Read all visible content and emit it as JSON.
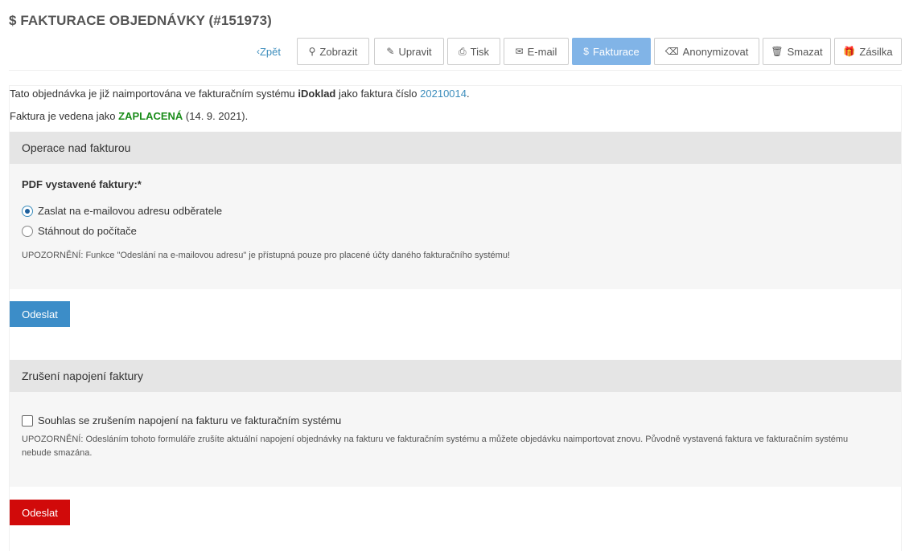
{
  "header": {
    "title": "$ FAKTURACE OBJEDNÁVKY (#151973)"
  },
  "toolbar": {
    "back": {
      "icon": "chevron-left-icon",
      "glyph": "‹",
      "label": "Zpět"
    },
    "buttons": [
      {
        "id": "zobrazit",
        "icon": "search-icon",
        "glyph": "⚲",
        "label": "Zobrazit"
      },
      {
        "id": "upravit",
        "icon": "pencil-icon",
        "glyph": "✎",
        "label": "Upravit"
      },
      {
        "id": "tisk",
        "icon": "print-icon",
        "glyph": "⎙",
        "label": "Tisk"
      },
      {
        "id": "email",
        "icon": "envelope-icon",
        "glyph": "✉",
        "label": "E-mail"
      },
      {
        "id": "fakturace",
        "icon": "dollar-icon",
        "glyph": "$",
        "label": "Fakturace",
        "active": true
      },
      {
        "id": "anonymizovat",
        "icon": "eraser-icon",
        "glyph": "⌫",
        "label": "Anonymizovat"
      },
      {
        "id": "smazat",
        "icon": "trash-icon",
        "glyph": "🗑",
        "label": "Smazat"
      },
      {
        "id": "zasilka",
        "icon": "gift-icon",
        "glyph": "🎁",
        "label": "Zásilka"
      }
    ]
  },
  "info": {
    "line1_prefix": "Tato objednávka je již naimportována ve fakturačním systému ",
    "system": "iDoklad",
    "line1_mid": " jako faktura číslo ",
    "invoice_number": "20210014",
    "line1_suffix": ".",
    "line2_prefix": "Faktura je vedena jako ",
    "status": "ZAPLACENÁ",
    "line2_suffix": " (14. 9. 2021).",
    "status_color": "#1a8c1a",
    "link_color": "#3c8dbc"
  },
  "invoice_ops": {
    "heading": "Operace nad fakturou",
    "field_label": "PDF vystavené faktury:*",
    "options": [
      {
        "label": "Zaslat na e-mailovou adresu odběratele",
        "checked": true
      },
      {
        "label": "Stáhnout do počítače",
        "checked": false
      }
    ],
    "note": "UPOZORNĚNÍ: Funkce \"Odeslání na e-mailovou adresu\" je přístupná pouze pro placené účty daného fakturačního systému!",
    "submit_label": "Odeslat",
    "submit_color": "#3c8dc8"
  },
  "unlink": {
    "heading": "Zrušení napojení faktury",
    "checkbox_label": "Souhlas se zrušením napojení na fakturu ve fakturačním systému",
    "checkbox_checked": false,
    "note": "UPOZORNĚNÍ: Odesláním tohoto formuláře zrušíte aktuální napojení objednávky na fakturu ve fakturačním systému a můžete objedávku naimportovat znovu. Původně vystavená faktura ve fakturačním systému nebude smazána.",
    "submit_label": "Odeslat",
    "submit_color": "#d10a0a"
  }
}
